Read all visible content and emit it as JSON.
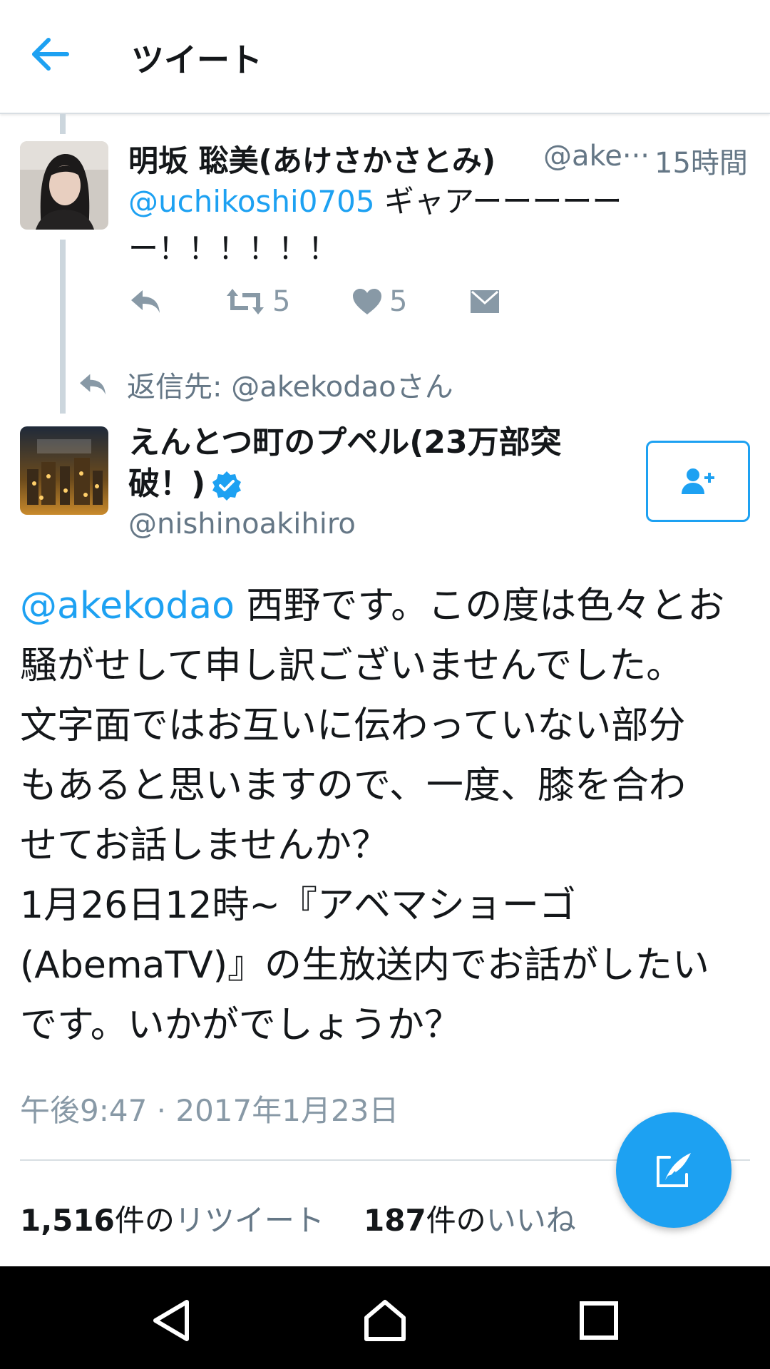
{
  "header": {
    "title": "ツイート",
    "back_icon": "arrow-left-icon"
  },
  "colors": {
    "accent": "#1da1f2",
    "text": "#14171a",
    "secondary": "#657786",
    "thread_line": "#ccd6dd"
  },
  "parent_tweet": {
    "author_name": "明坂 聡美(あけさかさとみ)",
    "handle": "@ake···",
    "time": "15時間",
    "mention": "@uchikoshi0705",
    "text_line1": " ギャアーーーーー",
    "text_line2": "ー！！！！！！",
    "actions": {
      "reply_icon": "reply-icon",
      "retweet_icon": "retweet-icon",
      "retweet_count": "5",
      "like_icon": "heart-icon",
      "like_count": "5",
      "dm_icon": "envelope-icon"
    }
  },
  "reply_to": {
    "label": "返信先: @akekodaoさん"
  },
  "main_tweet": {
    "author_name": "えんとつ町のプペル(23万部突破！)",
    "handle": "@nishinoakihiro",
    "follow_icon": "follow-user-icon",
    "mention": "@akekodao",
    "lines": [
      " 西野です。この度は色々とお",
      "騒がせして申し訳ございませんでした。",
      "文字面ではお互いに伝わっていない部分",
      "もあると思いますので、一度、膝を合わ",
      "せてお話しませんか？",
      "1月26日12時~『アベマショーゴ",
      "(AbemaTV)』の生放送内でお話がしたい",
      "です。いかがでしょうか？"
    ],
    "timestamp": "午後9:47 · 2017年1月23日",
    "stats": {
      "retweet_num": "1,516",
      "retweet_unit": "件の",
      "retweet_label": "リツイート",
      "like_num": "187",
      "like_unit": "件の",
      "like_label": "いいね"
    }
  },
  "fab": {
    "icon": "compose-tweet-icon"
  },
  "system_nav": {
    "back_icon": "nav-back-icon",
    "home_icon": "nav-home-icon",
    "recents_icon": "nav-recents-icon"
  }
}
